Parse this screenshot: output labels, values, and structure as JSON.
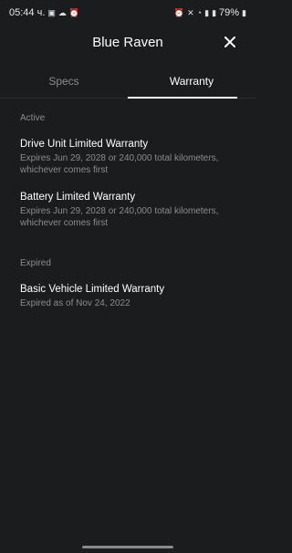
{
  "status_bar": {
    "time": "05:44 ч.",
    "battery": "79%"
  },
  "header": {
    "title": "Blue Raven"
  },
  "tabs": [
    {
      "label": "Specs",
      "active": false
    },
    {
      "label": "Warranty",
      "active": true
    }
  ],
  "active_section": {
    "label": "Active",
    "items": [
      {
        "name": "Drive Unit Limited Warranty",
        "desc": "Expires Jun 29, 2028 or 240,000 total kilometers, whichever comes first"
      },
      {
        "name": "Battery Limited Warranty",
        "desc": "Expires Jun 29, 2028 or 240,000 total kilometers, whichever comes first"
      }
    ]
  },
  "expired_section": {
    "label": "Expired",
    "items": [
      {
        "name": "Basic Vehicle Limited Warranty",
        "desc": "Expired as of Nov 24, 2022"
      }
    ]
  },
  "icons": {
    "close": "close-icon"
  },
  "colors": {
    "background": "#1b1c1e",
    "text_primary": "#ffffff",
    "text_secondary": "#8b8c90"
  }
}
